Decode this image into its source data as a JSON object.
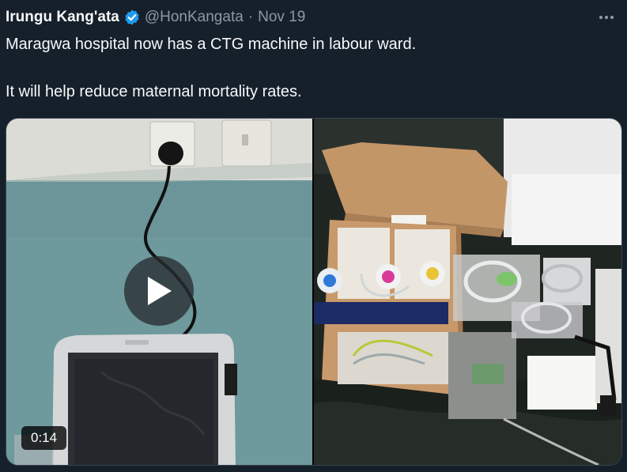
{
  "tweet": {
    "author": {
      "display_name": "Irungu Kang'ata",
      "handle": "@HonKangata",
      "verified_icon": "verified-badge-icon",
      "verified_color": "#1d9bf0"
    },
    "separator": "·",
    "date": "Nov 19",
    "more_icon": "more-options-icon",
    "text_lines": [
      "Maragwa hospital now has a CTG machine in labour ward.",
      "It will help reduce maternal mortality rates."
    ],
    "media": {
      "video_duration": "0:14",
      "play_icon": "play-icon"
    }
  },
  "colors": {
    "background": "#15202b",
    "text_primary": "#f7f9f9",
    "text_secondary": "#8b98a5",
    "border": "#38444d"
  }
}
